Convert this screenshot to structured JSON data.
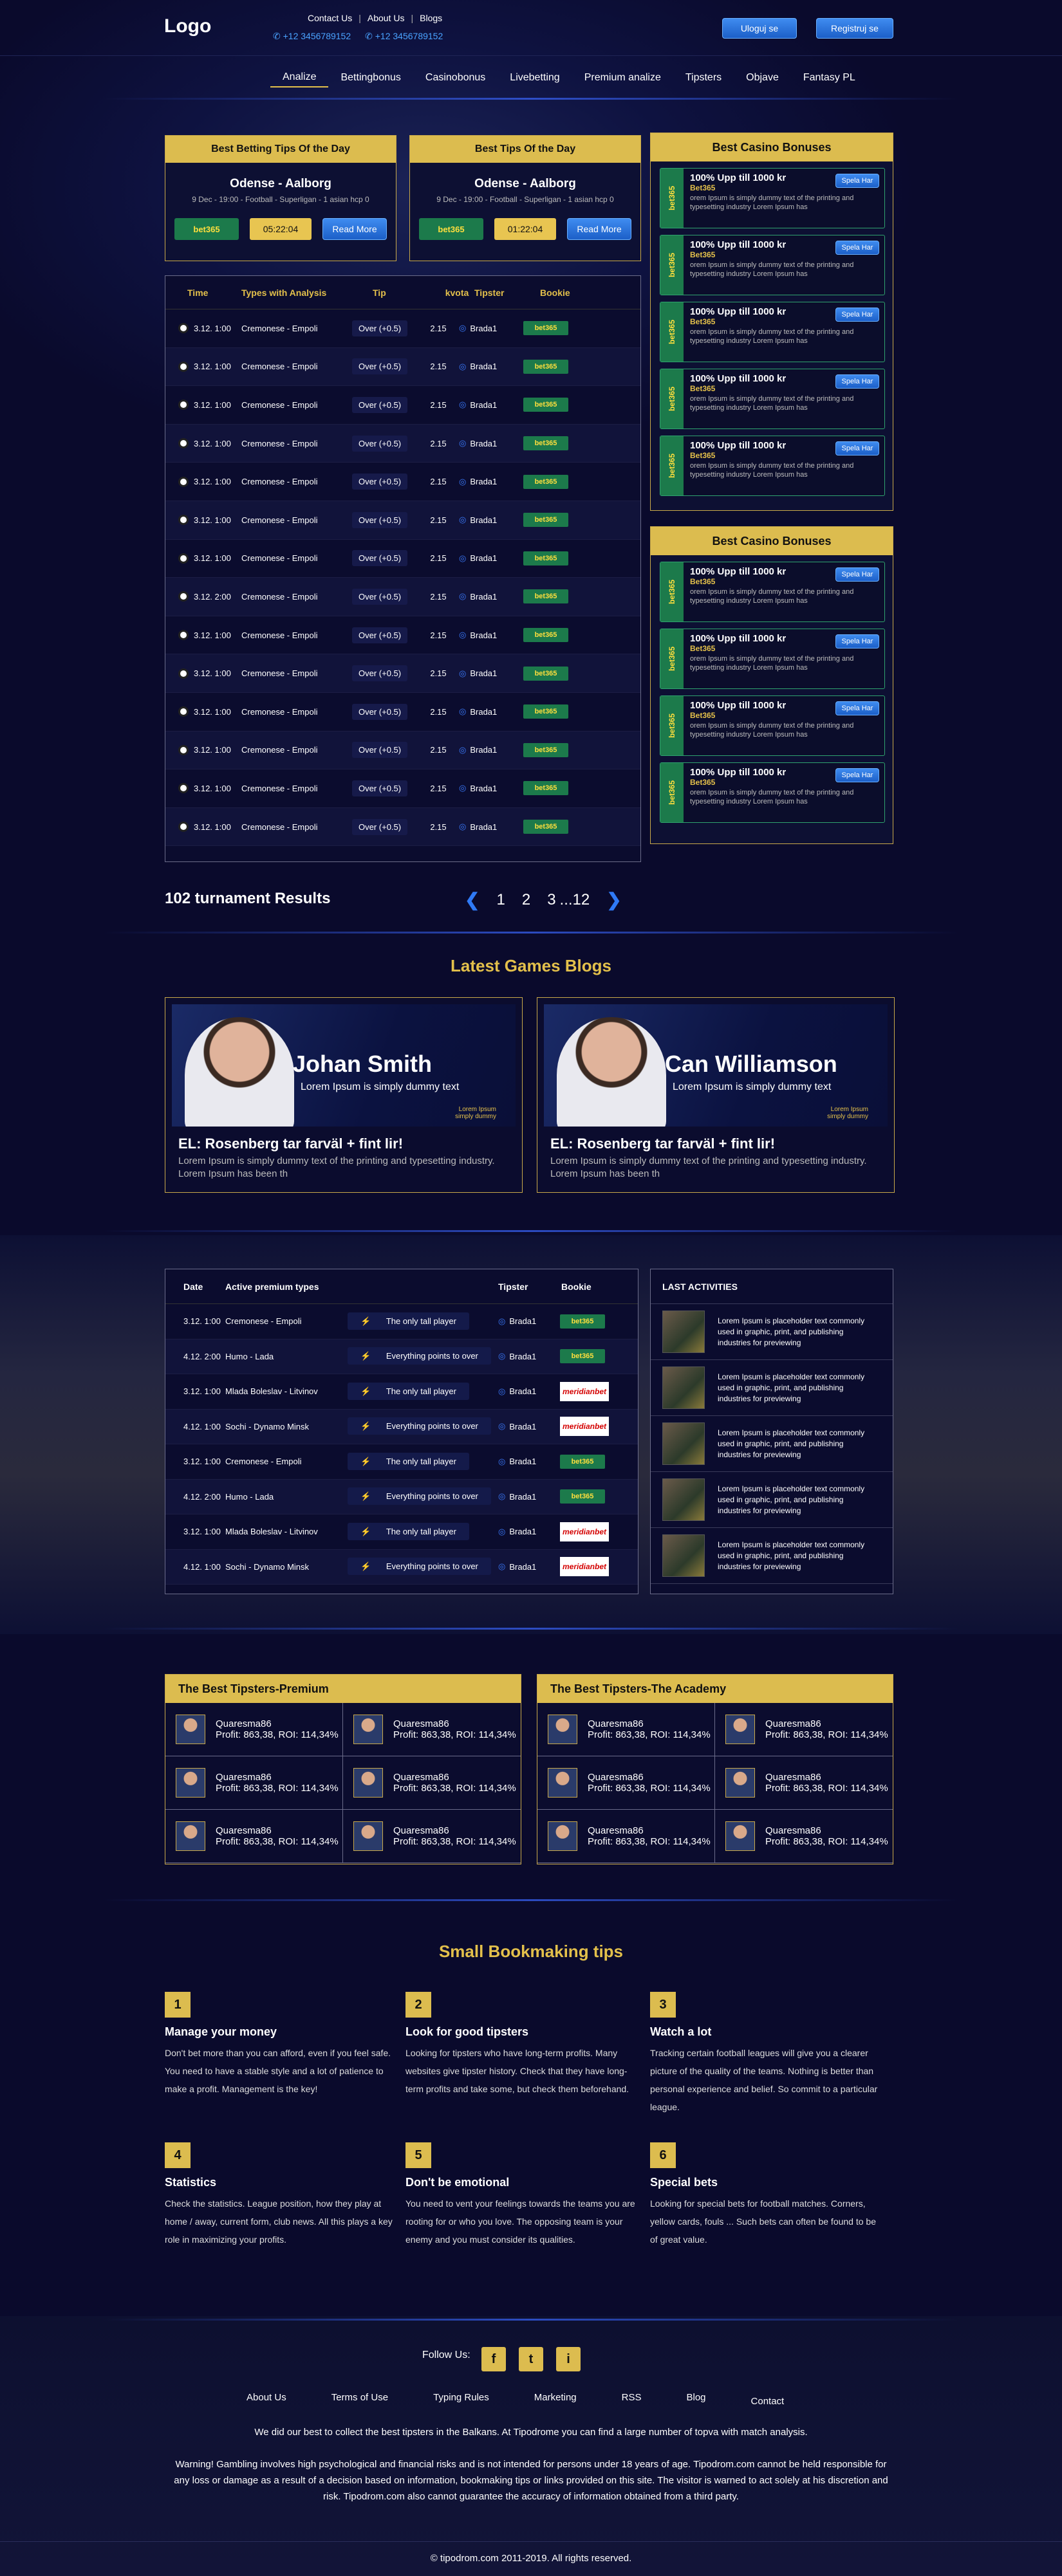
{
  "header": {
    "logo": "Logo",
    "links": [
      "Contact Us",
      "About Us",
      "Blogs"
    ],
    "phones": [
      "+12 3456789152",
      "+12 3456789152"
    ],
    "login": "Uloguj se",
    "register": "Registruj se"
  },
  "nav": [
    "Analize",
    "Bettingbonus",
    "Casinobonus",
    "Livebetting",
    "Premium analize",
    "Tipsters",
    "Objave",
    "Fantasy PL"
  ],
  "tip_cards": [
    {
      "title": "Best Betting Tips Of the Day",
      "match": "Odense - Aalborg",
      "meta": "9 Dec - 19:00 - Football - Superligan - 1 asian hcp 0",
      "bookie": "bet365",
      "time": "05:22:04",
      "button": "Read More"
    },
    {
      "title": "Best Tips Of the Day",
      "match": "Odense - Aalborg",
      "meta": "9 Dec - 19:00 - Football - Superligan - 1 asian hcp 0",
      "bookie": "bet365",
      "time": "01:22:04",
      "button": "Read More"
    }
  ],
  "tips_table": {
    "headers": [
      "Time",
      "Types with Analysis",
      "Tip",
      "kvota",
      "Tipster",
      "Bookie"
    ],
    "rows": [
      [
        "3.12. 1:00",
        "Cremonese - Empoli",
        "Over (+0.5)",
        "2.15",
        "Brada1",
        "bet365"
      ],
      [
        "3.12. 1:00",
        "Cremonese - Empoli",
        "Over (+0.5)",
        "2.15",
        "Brada1",
        "bet365"
      ],
      [
        "3.12. 1:00",
        "Cremonese - Empoli",
        "Over (+0.5)",
        "2.15",
        "Brada1",
        "bet365"
      ],
      [
        "3.12. 1:00",
        "Cremonese - Empoli",
        "Over (+0.5)",
        "2.15",
        "Brada1",
        "bet365"
      ],
      [
        "3.12. 1:00",
        "Cremonese - Empoli",
        "Over (+0.5)",
        "2.15",
        "Brada1",
        "bet365"
      ],
      [
        "3.12. 1:00",
        "Cremonese - Empoli",
        "Over (+0.5)",
        "2.15",
        "Brada1",
        "bet365"
      ],
      [
        "3.12. 1:00",
        "Cremonese - Empoli",
        "Over (+0.5)",
        "2.15",
        "Brada1",
        "bet365"
      ],
      [
        "3.12. 2:00",
        "Cremonese - Empoli",
        "Over (+0.5)",
        "2.15",
        "Brada1",
        "bet365"
      ],
      [
        "3.12. 1:00",
        "Cremonese - Empoli",
        "Over (+0.5)",
        "2.15",
        "Brada1",
        "bet365"
      ],
      [
        "3.12. 1:00",
        "Cremonese - Empoli",
        "Over (+0.5)",
        "2.15",
        "Brada1",
        "bet365"
      ],
      [
        "3.12. 1:00",
        "Cremonese - Empoli",
        "Over (+0.5)",
        "2.15",
        "Brada1",
        "bet365"
      ],
      [
        "3.12. 1:00",
        "Cremonese - Empoli",
        "Over (+0.5)",
        "2.15",
        "Brada1",
        "bet365"
      ],
      [
        "3.12. 1:00",
        "Cremonese - Empoli",
        "Over (+0.5)",
        "2.15",
        "Brada1",
        "bet365"
      ],
      [
        "3.12. 1:00",
        "Cremonese - Empoli",
        "Over (+0.5)",
        "2.15",
        "Brada1",
        "bet365"
      ]
    ]
  },
  "casino": {
    "title": "Best Casino Bonuses",
    "item_title": "100% Upp till 1000 kr",
    "item_bookie": "Bet365",
    "side": "bet365",
    "desc": "orem Ipsum is simply dummy text of the printing and typesetting industry Lorem Ipsum has",
    "button": "Spela Har"
  },
  "pagination": {
    "results": "102 turnament Results",
    "pages": [
      "1",
      "2",
      "3",
      "...12"
    ]
  },
  "blogs": {
    "title": "Latest Games Blogs",
    "items": [
      {
        "name": "Johan Smith",
        "sub": "Lorem Ipsum is simply dummy text",
        "small1": "Lorem Ipsum",
        "small2": "simply dummy",
        "title": "EL: Rosenberg tar farväl + fint lir!",
        "text": "Lorem Ipsum is simply dummy text of the printing and typesetting industry. Lorem Ipsum has been th"
      },
      {
        "name": "Can Williamson",
        "sub": "Lorem Ipsum is simply dummy text",
        "small1": "Lorem Ipsum",
        "small2": "simply dummy",
        "title": "EL: Rosenberg tar farväl + fint lir!",
        "text": "Lorem Ipsum is simply dummy text of the printing and typesetting industry. Lorem Ipsum has been th"
      }
    ]
  },
  "premium": {
    "headers": [
      "Date",
      "Active premium types",
      "Tipster",
      "Bookie"
    ],
    "rows": [
      [
        "3.12. 1:00",
        "Cremonese - Empoli",
        "The only tall player",
        "Brada1",
        "bet365"
      ],
      [
        "4.12. 2:00",
        "Humo - Lada",
        "Everything points to over",
        "Brada1",
        "bet365"
      ],
      [
        "3.12. 1:00",
        "Mlada Boleslav - Litvinov",
        "The only tall player",
        "Brada1",
        "meridianbet"
      ],
      [
        "4.12. 1:00",
        "Sochi - Dynamo Minsk",
        "Everything points to over",
        "Brada1",
        "meridianbet"
      ],
      [
        "3.12. 1:00",
        "Cremonese - Empoli",
        "The only tall player",
        "Brada1",
        "bet365"
      ],
      [
        "4.12. 2:00",
        "Humo - Lada",
        "Everything points to over",
        "Brada1",
        "bet365"
      ],
      [
        "3.12. 1:00",
        "Mlada Boleslav - Litvinov",
        "The only tall player",
        "Brada1",
        "meridianbet"
      ],
      [
        "4.12. 1:00",
        "Sochi - Dynamo Minsk",
        "Everything points to over",
        "Brada1",
        "meridianbet"
      ]
    ]
  },
  "activities": {
    "title": "LAST ACTIVITIES",
    "text": "Lorem Ipsum is placeholder text commonly used in graphic, print, and publishing industries for previewing"
  },
  "tipsters": {
    "premium_title": "The Best Tipsters-Premium",
    "academy_title": "The Best Tipsters-The Academy",
    "name": "Quaresma86",
    "profit": "Profit: 863,38, ROI: 114,34%"
  },
  "bookmaking": {
    "title": "Small Bookmaking tips",
    "items": [
      {
        "num": "1",
        "title": "Manage your money",
        "text": "Don't bet more than you can afford, even if you feel safe. You need to have a stable style and a lot of patience to make a profit. Management is the key!"
      },
      {
        "num": "2",
        "title": "Look for good tipsters",
        "text": "Looking for tipsters who have long-term profits. Many websites give tipster history. Check that they have long-term profits and take some, but check them beforehand."
      },
      {
        "num": "3",
        "title": "Watch a lot",
        "text": "Tracking certain football leagues will give you a clearer picture of the quality of the teams. Nothing is better than personal experience and belief. So commit to a particular league."
      },
      {
        "num": "4",
        "title": "Statistics",
        "text": "Check the statistics. League position, how they play at home / away, current form, club news. All this plays a key role in maximizing your profits."
      },
      {
        "num": "5",
        "title": "Don't be emotional",
        "text": "You need to vent your feelings towards the teams you are rooting for or who you love. The opposing team is your enemy and you must consider its qualities."
      },
      {
        "num": "6",
        "title": "Special bets",
        "text": "Looking for special bets for football matches. Corners, yellow cards, fouls ... Such bets can often be found to be of great value."
      }
    ]
  },
  "footer": {
    "follow": "Follow Us:",
    "social": [
      "f",
      "t",
      "i"
    ],
    "links": [
      "About Us",
      "Terms of Use",
      "Typing Rules",
      "Marketing",
      "RSS",
      "Blog",
      "Contact"
    ],
    "text1": "We did our best to collect the best tipsters in the Balkans. At Tipodrome you can find a large number of topva with match analysis.",
    "text2": "Warning! Gambling involves high psychological and financial risks and is not intended for persons under 18 years of age. Tipodrom.com cannot be held responsible for any loss or damage as a result of a decision based on information, bookmaking tips or links provided on this site. The visitor is warned to act solely at his discretion and risk. Tipodrom.com also cannot guarantee the accuracy of information obtained from a third party.",
    "copyright": "© tipodrom.com 2011-2019. All rights reserved."
  }
}
